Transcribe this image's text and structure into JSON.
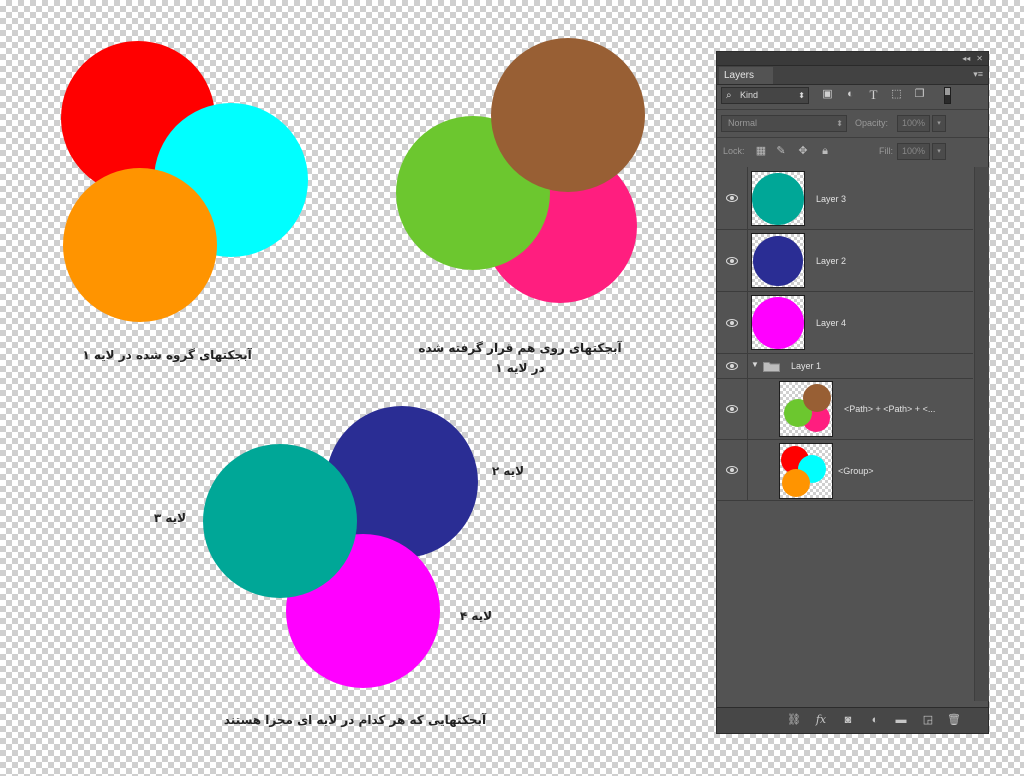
{
  "canvas": {
    "captions": {
      "grouped": "آبجکتهای گروه شده در لایه ۱",
      "stacked_line1": "آبجکتهای روی هم قرار گرفته شده",
      "stacked_line2": "در لایه ۱",
      "separate": "آبجکتهایی که هر کدام در لایه ای مجزا هستند",
      "label_layer2": "لایه ۲",
      "label_layer3": "لایه ۳",
      "label_layer4": "لایه ۴"
    },
    "colors": {
      "red": "#ff0000",
      "cyan": "#00ffff",
      "orange": "#ff9400",
      "green": "#6cc72f",
      "pink": "#ff1e7f",
      "brown": "#985f34",
      "teal": "#00a797",
      "navy": "#2a2d94",
      "magenta": "#ff00ff"
    }
  },
  "panel": {
    "tab_label": "Layers",
    "filter_kind": "Kind",
    "blend_mode": "Normal",
    "opacity_label": "Opacity:",
    "opacity_value": "100%",
    "lock_label": "Lock:",
    "fill_label": "Fill:",
    "fill_value": "100%",
    "layers": [
      {
        "name": "Layer 3",
        "visible": true,
        "thumb": "teal"
      },
      {
        "name": "Layer 2",
        "visible": true,
        "thumb": "navy"
      },
      {
        "name": "Layer 4",
        "visible": true,
        "thumb": "magenta"
      },
      {
        "name": "Layer 1",
        "visible": true,
        "type": "group",
        "expanded": true
      },
      {
        "name": "<Path> + <Path> + <...",
        "visible": true,
        "thumb": "stacked"
      },
      {
        "name": "<Group>",
        "visible": true,
        "thumb": "grouped"
      }
    ]
  }
}
